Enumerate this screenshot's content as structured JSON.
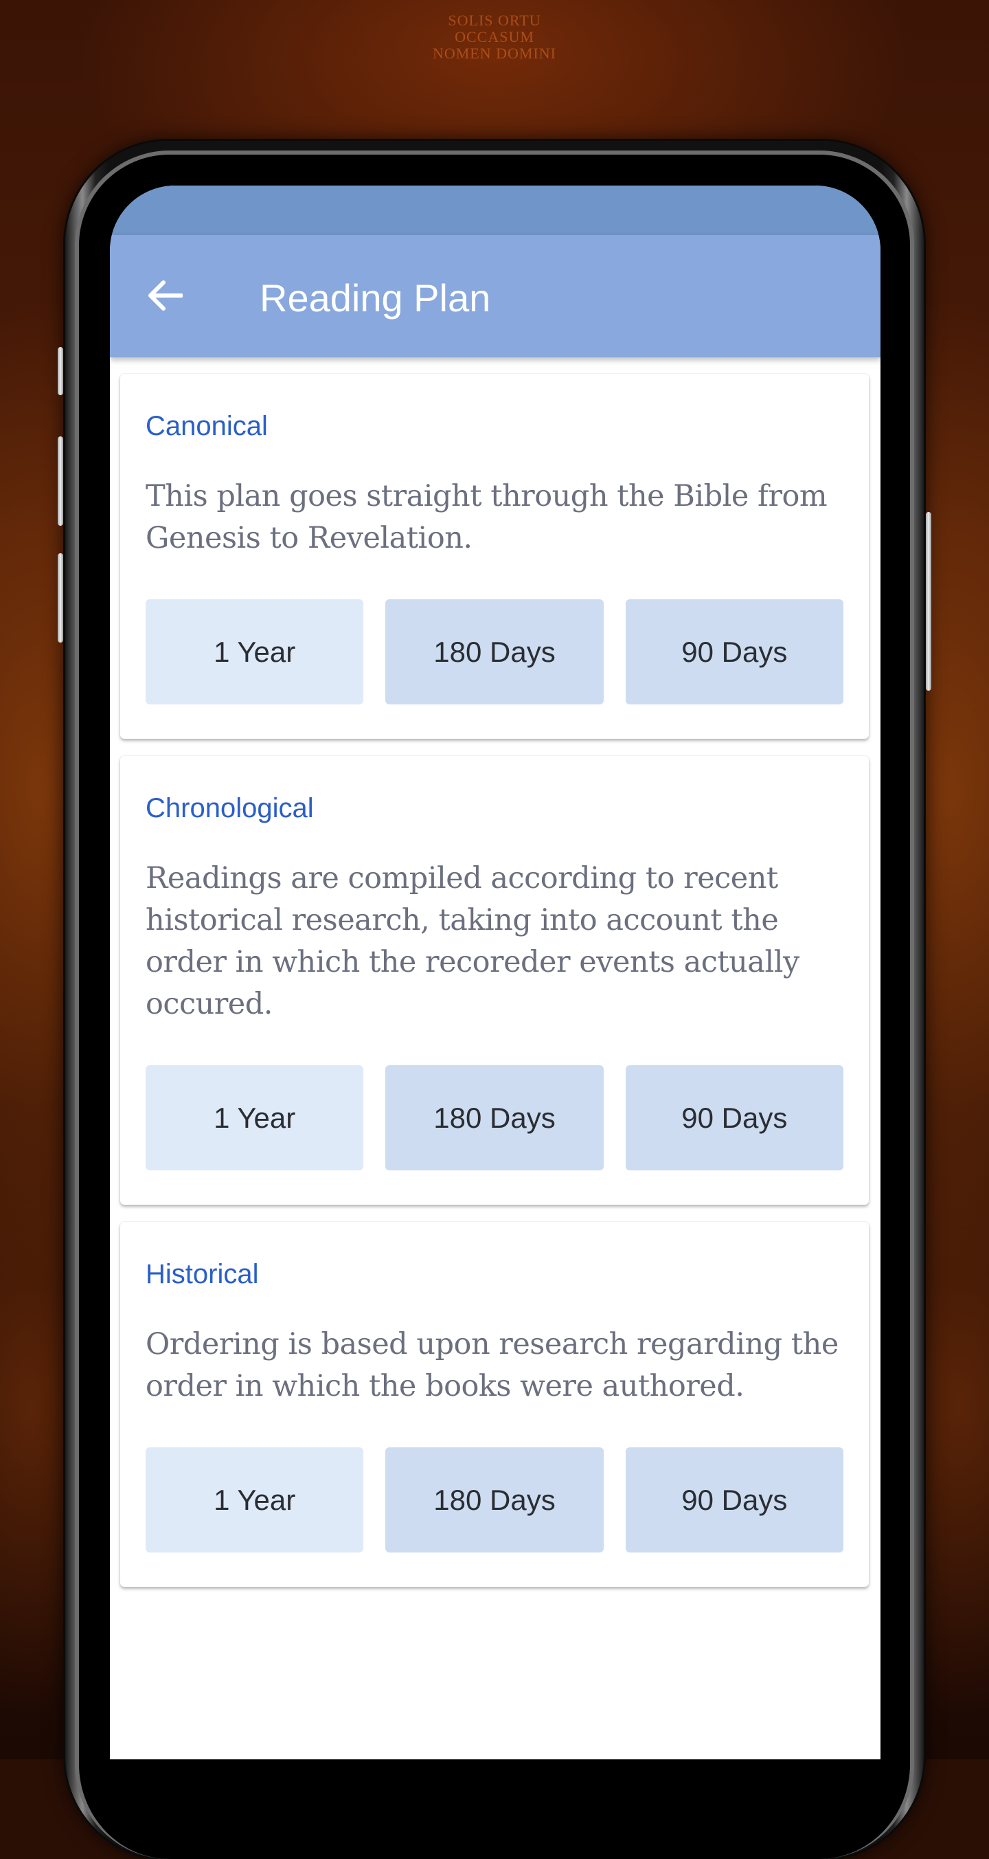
{
  "background": {
    "inscription": [
      "SOLIS ORTU",
      "OCCASUM",
      "NOMEN DOMINI"
    ]
  },
  "status_bar": {
    "color": "#7095c8"
  },
  "app_bar": {
    "title": "Reading Plan",
    "back_icon": "arrow-left-icon",
    "color": "#88a8de"
  },
  "plans": [
    {
      "title": "Canonical",
      "description": "This plan goes straight through the Bible from Genesis to Revelation.",
      "options": [
        "1 Year",
        "180 Days",
        "90 Days"
      ]
    },
    {
      "title": "Chronological",
      "description": "Readings are compiled according to recent historical research, taking into account the order in which the recoreder events actually occured.",
      "options": [
        "1 Year",
        "180 Days",
        "90 Days"
      ]
    },
    {
      "title": "Historical",
      "description": "Ordering is based upon research regarding the order in which the books were authored.",
      "options": [
        "1 Year",
        "180 Days",
        "90 Days"
      ]
    }
  ],
  "colors": {
    "title_accent": "#2a5fc9",
    "description_text": "#6b6f7e",
    "button_light": "#dfeaf9",
    "button_default": "#cddcf0",
    "button_text": "#2a2d33"
  }
}
